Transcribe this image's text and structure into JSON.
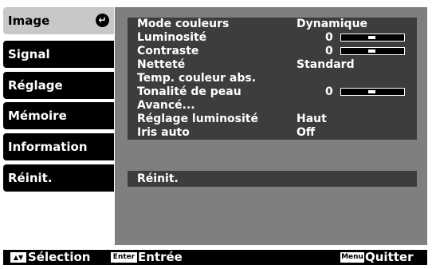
{
  "menu": {
    "items": [
      {
        "label": "Image"
      },
      {
        "label": "Signal"
      },
      {
        "label": "Réglage"
      },
      {
        "label": "Mémoire"
      },
      {
        "label": "Information"
      },
      {
        "label": "Réinit."
      }
    ],
    "active_index": 0
  },
  "settings": {
    "rows": [
      {
        "label": "Mode couleurs",
        "value": "Dynamique"
      },
      {
        "label": "Luminosité",
        "value": "0",
        "slider_level": 0.5
      },
      {
        "label": "Contraste",
        "value": "0",
        "slider_level": 0.5
      },
      {
        "label": "Netteté",
        "value": "Standard"
      },
      {
        "label": "Temp. couleur abs.",
        "value": ""
      },
      {
        "label": "Tonalité de peau",
        "value": "0",
        "slider_level": 0.5
      },
      {
        "label": "Avancé...",
        "value": ""
      },
      {
        "label": "Réglage luminosité",
        "value": "Haut"
      },
      {
        "label": "Iris auto",
        "value": "Off"
      }
    ],
    "reset_label": "Réinit."
  },
  "bottombar": {
    "select_key": "▲▼",
    "select_label": "Sélection",
    "enter_key": "Enter",
    "enter_label": "Entrée",
    "menu_key": "Menu",
    "quit_label": "Quitter"
  },
  "colors": {
    "panel": "#7f7f7f",
    "row_bg": "#3d3d3d",
    "active_tab": "#c8c8c8"
  }
}
